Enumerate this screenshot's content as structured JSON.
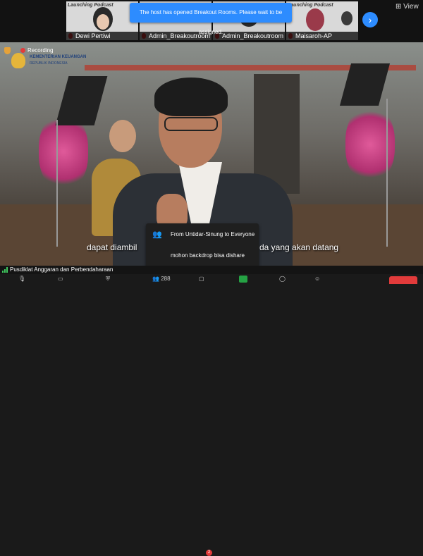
{
  "participants": [
    {
      "name": "Dewi Pertiwi",
      "banner": "Launching Podcast",
      "muted": true
    },
    {
      "name": "Admin_Breakoutroom",
      "banner": "",
      "muted": true
    },
    {
      "name": "Admin_Breakoutroom",
      "banner": "",
      "muted": true
    },
    {
      "name": "Maisaroh-AP",
      "banner": "Launching Podcast",
      "muted": true
    }
  ],
  "topbar": {
    "next_icon": "chevron-right-icon",
    "next_glyph": "›",
    "view_label": "View",
    "view_glyph": "⊞"
  },
  "notification": "The host has opened Breakout Rooms. Please wait to be assigned.",
  "recording": {
    "label": "Recording"
  },
  "logo": {
    "line1": "KEMENTERIAN KEUANGAN",
    "line2": "REPUBLIK INDONESIA"
  },
  "subtitle": {
    "left": "dapat diambil",
    "right": "da yang akan datang"
  },
  "chat": {
    "from": "From Untidar-Sinung to Everyone",
    "message": "mohon backdrop bisa dishare",
    "avatar_icon": "people-icon",
    "avatar_glyph": "👥"
  },
  "status_bar": {
    "meeting_name": "Pusdiklat Anggaran dan Perbendaharaan"
  },
  "toolbar": {
    "participants_count": "288",
    "chat_badge": "2",
    "colors": {
      "share": "#25a244",
      "end": "#e23b3b",
      "accent": "#2d8cff"
    }
  }
}
